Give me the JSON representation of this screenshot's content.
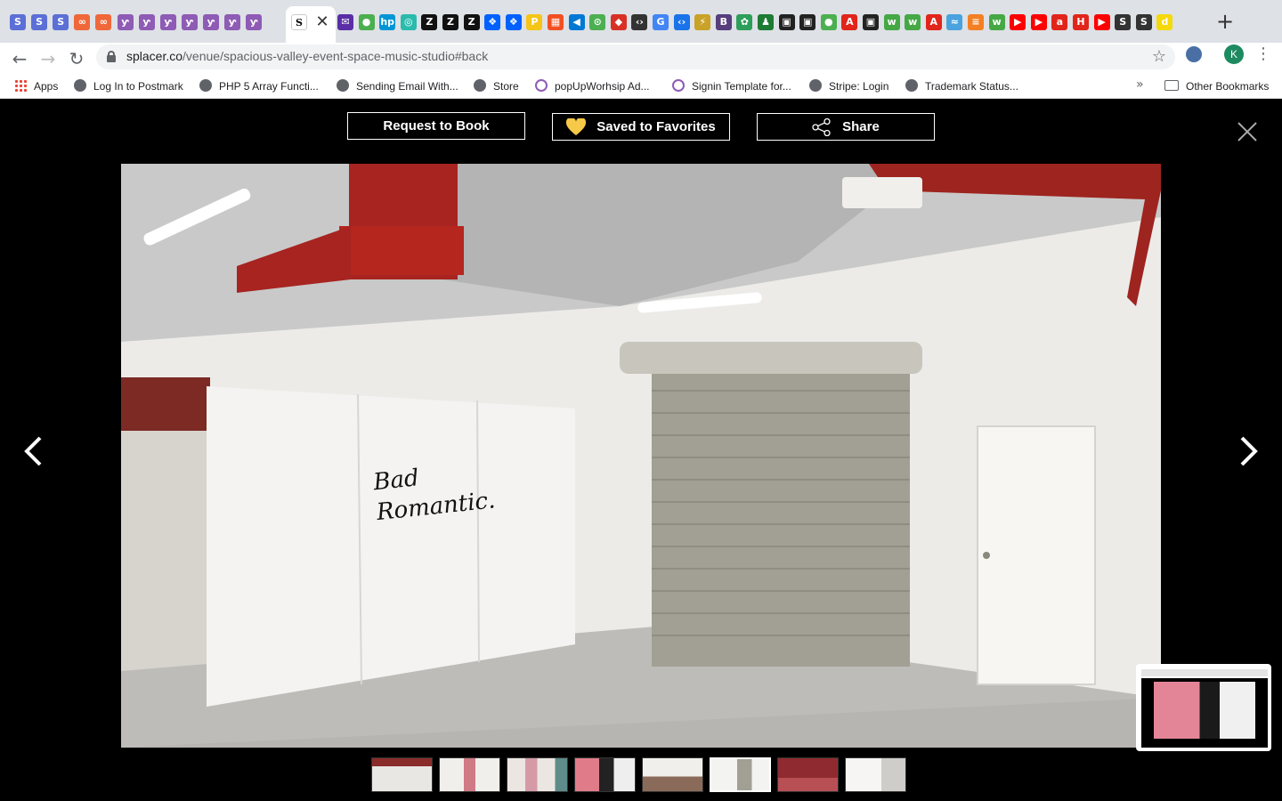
{
  "browser": {
    "active_tab_favicon": "S",
    "tab_favicons": [
      {
        "glyph": "S",
        "color": "#5b6fd6"
      },
      {
        "glyph": "S",
        "color": "#5b6fd6"
      },
      {
        "glyph": "S",
        "color": "#5b6fd6"
      },
      {
        "glyph": "∞",
        "color": "#f0683a"
      },
      {
        "glyph": "∞",
        "color": "#f0683a"
      },
      {
        "glyph": "ƴ",
        "color": "#8e5bb5"
      },
      {
        "glyph": "ƴ",
        "color": "#8e5bb5"
      },
      {
        "glyph": "ƴ",
        "color": "#8e5bb5"
      },
      {
        "glyph": "ƴ",
        "color": "#8e5bb5"
      },
      {
        "glyph": "ƴ",
        "color": "#8e5bb5"
      },
      {
        "glyph": "ƴ",
        "color": "#8e5bb5"
      },
      {
        "glyph": "ƴ",
        "color": "#8e5bb5"
      }
    ],
    "tab_favicons_right": [
      {
        "glyph": "✉",
        "color": "#5a2ea6"
      },
      {
        "glyph": "●",
        "color": "#4caf50"
      },
      {
        "glyph": "hp",
        "color": "#0096d6"
      },
      {
        "glyph": "◎",
        "color": "#2bbbad"
      },
      {
        "glyph": "Z",
        "color": "#111111"
      },
      {
        "glyph": "Z",
        "color": "#111111"
      },
      {
        "glyph": "Z",
        "color": "#111111"
      },
      {
        "glyph": "❖",
        "color": "#0061ff"
      },
      {
        "glyph": "❖",
        "color": "#0061ff"
      },
      {
        "glyph": "P",
        "color": "#f5c518"
      },
      {
        "glyph": "▦",
        "color": "#f25022"
      },
      {
        "glyph": "◀",
        "color": "#0078d4"
      },
      {
        "glyph": "⊙",
        "color": "#4caf50"
      },
      {
        "glyph": "◆",
        "color": "#d93025"
      },
      {
        "glyph": "‹›",
        "color": "#333333"
      },
      {
        "glyph": "G",
        "color": "#4285f4"
      },
      {
        "glyph": "‹›",
        "color": "#1a73e8"
      },
      {
        "glyph": "⚡",
        "color": "#c9a227"
      },
      {
        "glyph": "B",
        "color": "#563d7c"
      },
      {
        "glyph": "✿",
        "color": "#2e9e5b"
      },
      {
        "glyph": "♟",
        "color": "#1e7b34"
      },
      {
        "glyph": "▣",
        "color": "#222222"
      },
      {
        "glyph": "▣",
        "color": "#222222"
      },
      {
        "glyph": "●",
        "color": "#4caf50"
      },
      {
        "glyph": "A",
        "color": "#e1251b"
      },
      {
        "glyph": "▣",
        "color": "#222222"
      },
      {
        "glyph": "w",
        "color": "#45a845"
      },
      {
        "glyph": "w",
        "color": "#45a845"
      },
      {
        "glyph": "A",
        "color": "#e1251b"
      },
      {
        "glyph": "≈",
        "color": "#4aa3df"
      },
      {
        "glyph": "≡",
        "color": "#f48024"
      },
      {
        "glyph": "w",
        "color": "#45a845"
      },
      {
        "glyph": "▶",
        "color": "#ff0000"
      },
      {
        "glyph": "▶",
        "color": "#ff0000"
      },
      {
        "glyph": "a",
        "color": "#e1251b"
      },
      {
        "glyph": "H",
        "color": "#e1251b"
      },
      {
        "glyph": "▶",
        "color": "#ff0000"
      },
      {
        "glyph": "S",
        "color": "#333333"
      },
      {
        "glyph": "S",
        "color": "#333333"
      },
      {
        "glyph": "d",
        "color": "#f5d90a"
      }
    ],
    "url_domain": "splacer.co",
    "url_path": "/venue/spacious-valley-event-space-music-studio#back",
    "profile_initial": "K",
    "bookmarks": [
      {
        "label": "Apps",
        "icon": "apps-grid-icon"
      },
      {
        "label": "Log In to Postmark",
        "icon": "globe-icon"
      },
      {
        "label": "PHP 5 Array Functi...",
        "icon": "globe-icon"
      },
      {
        "label": "Sending Email With...",
        "icon": "globe-icon"
      },
      {
        "label": "Store",
        "icon": "globe-icon"
      },
      {
        "label": "popUpWorhsip Ad...",
        "icon": "popupworship-icon"
      },
      {
        "label": "Signin Template for...",
        "icon": "popupworship-icon"
      },
      {
        "label": "Stripe: Login",
        "icon": "globe-icon"
      },
      {
        "label": "Trademark Status...",
        "icon": "globe-icon"
      }
    ],
    "other_bookmarks": "Other Bookmarks"
  },
  "lightbox": {
    "request_label": "Request to Book",
    "favorites_label": "Saved to Favorites",
    "share_label": "Share",
    "photo_signage_line1": "Bad",
    "photo_signage_line2": "Romantic.",
    "thumbnail_count": 8,
    "active_thumbnail": 6
  },
  "colors": {
    "heart": "#f7c948",
    "background": "#000000"
  }
}
